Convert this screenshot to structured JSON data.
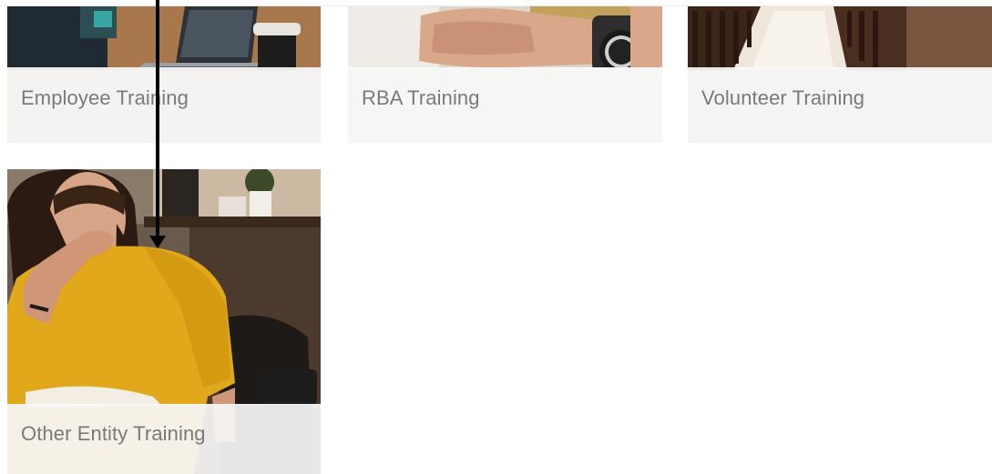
{
  "cards": [
    {
      "title": "Employee Training"
    },
    {
      "title": "RBA Training"
    },
    {
      "title": "Volunteer Training"
    },
    {
      "title": "Other Entity Training"
    }
  ],
  "colors": {
    "caption_overlay": "#f6f6f6",
    "title_text": "#7a7a7a",
    "mustard_shirt": "#e2a81c",
    "pointer": "#000000"
  },
  "icons": {
    "pointer": "arrow-pointer-icon"
  }
}
